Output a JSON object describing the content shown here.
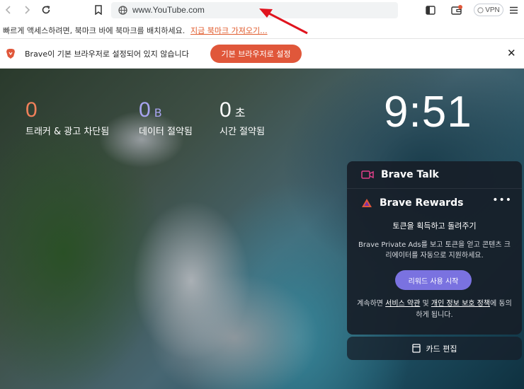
{
  "toolbar": {
    "url": "www.YouTube.com",
    "vpn_label": "VPN"
  },
  "bookmark_bar": {
    "hint": "빠르게 액세스하려면, 북마크 바에 북마크를 배치하세요.",
    "import_link": "지금 북마크 가져오기..."
  },
  "info_bar": {
    "message": "Brave이 기본 브라우저로 설정되어 있지 않습니다",
    "set_default_button": "기본 브라우저로 설정",
    "close": "✕"
  },
  "stats": [
    {
      "value": "0",
      "unit": "",
      "label": "트래커 & 광고 차단됨",
      "color": "#f0805a"
    },
    {
      "value": "0",
      "unit": "B",
      "label": "데이터 절약됨",
      "color": "#a8a4f0"
    },
    {
      "value": "0",
      "unit": "초",
      "label": "시간 절약됨",
      "color": "#ffffff"
    }
  ],
  "clock": "9:51",
  "brave_talk": {
    "title": "Brave Talk"
  },
  "brave_rewards": {
    "title": "Brave Rewards",
    "menu": "•••",
    "subtitle": "토큰을 획득하고 돌려주기",
    "description": "Brave Private Ads를 보고 토큰을 얻고 콘텐츠 크리에이터를 자동으로 지원하세요.",
    "start_button": "리워드 사용 시작",
    "terms_prefix": "계속하면 ",
    "terms_link": "서비스 약관",
    "terms_and": " 및 ",
    "privacy_link": "개인 정보 보호 정책",
    "terms_suffix": "에 동의하게 됩니다."
  },
  "edit_cards": {
    "label": "카드 편집"
  },
  "colors": {
    "accent": "#e0573a",
    "rewards_button": "#7a72e0",
    "arrow": "#e0141e"
  }
}
